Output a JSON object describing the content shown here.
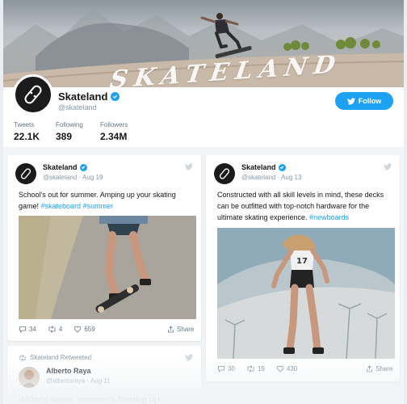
{
  "banner": {
    "title": "SKATELAND"
  },
  "profile": {
    "name": "Skateland",
    "handle": "@skateland",
    "follow_label": "Follow",
    "stats": [
      {
        "label": "Tweets",
        "value": "22.1K"
      },
      {
        "label": "Following",
        "value": "389"
      },
      {
        "label": "Followers",
        "value": "2.34M"
      }
    ]
  },
  "tweets": [
    {
      "name": "Skateland",
      "handle": "@skateland",
      "date": "Aug 19",
      "text": "School's out for summer. Amping up your skating game!",
      "tags": [
        "#skateboard",
        "#summer"
      ],
      "replies": "34",
      "retweets": "4",
      "likes": "659",
      "share_label": "Share"
    },
    {
      "name": "Skateland",
      "handle": "@skateland",
      "date": "Aug 13",
      "text": "Constructed with all skill levels in mind, these decks can be outfitted with top-notch hardware for the ultimate skating experience.",
      "tags": [
        "#newboards"
      ],
      "replies": "30",
      "retweets": "19",
      "likes": "430",
      "share_label": "Share"
    },
    {
      "retweeted_label": "Skateland Retweeted",
      "name": "Alberto Raya",
      "handle": "@albertoraya",
      "date": "Aug 11",
      "text": "Water's warm, summer's heating up..."
    }
  ],
  "colors": {
    "accent": "#1da1f2",
    "text": "#14171a",
    "muted": "#8899a6",
    "background": "#f1f4f6"
  }
}
